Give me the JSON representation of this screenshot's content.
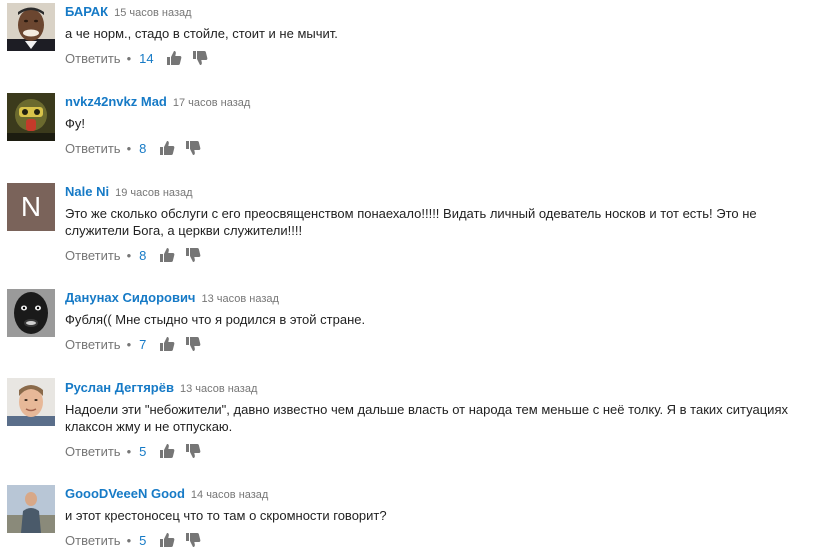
{
  "reply_label": "Ответить",
  "dot": "•",
  "comments": [
    {
      "author": "БАРАК",
      "time": "15 часов назад",
      "text": "а че норм., стадо в стойле, стоит и не мычит.",
      "likes": "14",
      "avatar": "photo-portrait-smiling-man"
    },
    {
      "author": "nvkz42nvkz Mad",
      "time": "17 часов назад",
      "text": "Фу!",
      "likes": "8",
      "avatar": "gas-mask-avatar"
    },
    {
      "author": "Nale Ni",
      "time": "19 часов назад",
      "text": "Это же сколько обслуги с его преосвященством понаехало!!!!! Видать личный  одеватель носков и тот есть! Это не служители Бога, а церкви служители!!!!",
      "likes": "8",
      "avatar": "letter-avatar",
      "avatar_letter": "N",
      "avatar_color": "#7a635a"
    },
    {
      "author": "Данунах Сидорович",
      "time": "13 часов назад",
      "text": "Фубля(( Мне стыдно что я родился в этой стране.",
      "likes": "7",
      "avatar": "dark-portrait-avatar"
    },
    {
      "author": "Руслан Дегтярёв",
      "time": "13 часов назад",
      "text": "Надоели эти \"небожители\", давно известно чем дальше власть от народа тем меньше с неё толку. Я в таких ситуациях клаксон жму и не отпускаю.",
      "likes": "5",
      "avatar": "photo-portrait-young-man"
    },
    {
      "author": "GoooDVeeeN Good",
      "time": "14 часов назад",
      "text": "и этот крестоносец что то там о скромности говорит?",
      "likes": "5",
      "avatar": "photo-person-outdoor"
    }
  ],
  "colors": {
    "author": "#167ac6",
    "muted": "#767676",
    "text": "#222222",
    "thumb": "#767676"
  }
}
